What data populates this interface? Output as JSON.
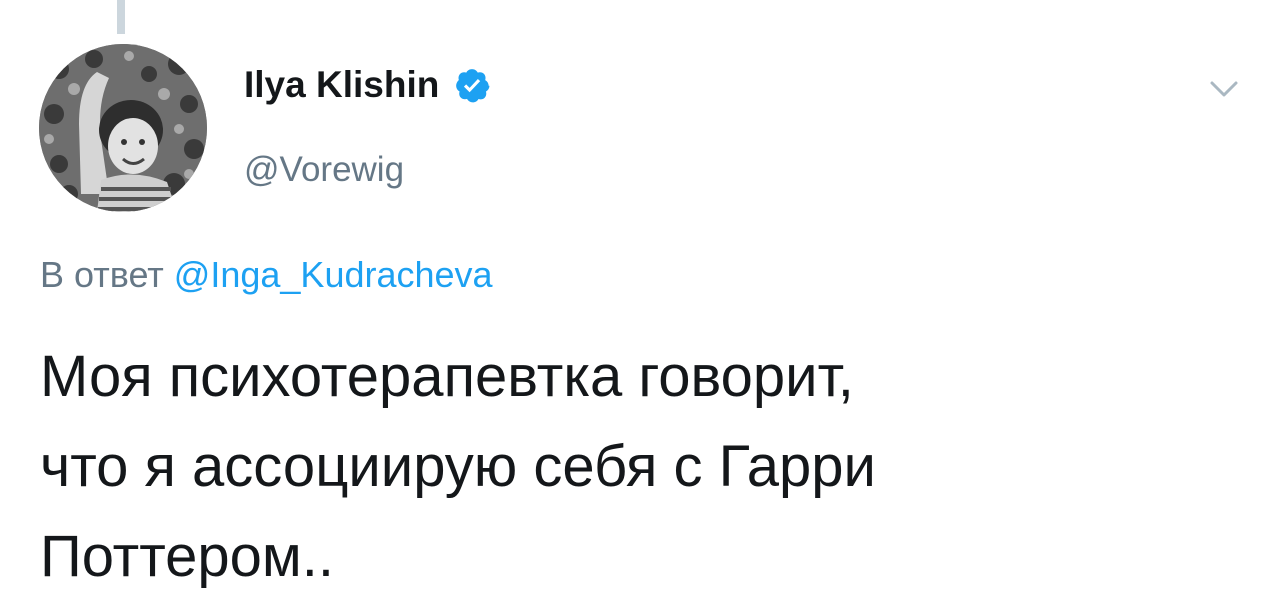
{
  "author": {
    "name": "Ilya Klishin",
    "handle": "@Vorewig",
    "verified": true,
    "avatar_icon": "avatar-photo-icon"
  },
  "reply": {
    "prefix": "В ответ",
    "mention": "@Inga_Kudracheva"
  },
  "tweet": {
    "lines": [
      "Моя психотерапевтка говорит,",
      "что я ассоциирую себя с Гарри",
      "Поттером.."
    ]
  },
  "icons": {
    "verified": "verified-badge-icon",
    "menu": "chevron-down-icon"
  },
  "colors": {
    "verified": "#1da1f2",
    "mention": "#1da1f2",
    "secondary_text": "#657786",
    "primary_text": "#14171a"
  }
}
